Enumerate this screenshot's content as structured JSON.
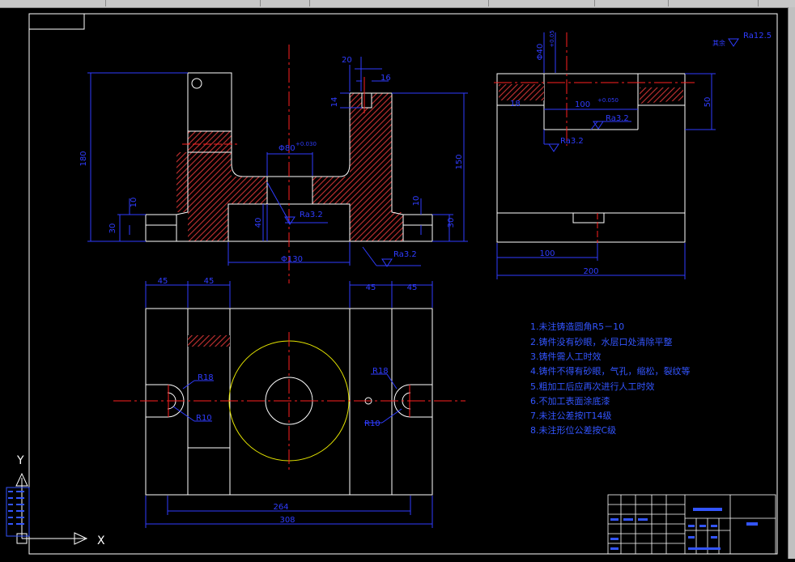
{
  "colors": {
    "background": "#000000",
    "outline": "#ffffff",
    "dimension": "#2f3cff",
    "centerline": "#ff2020",
    "hatch": "#c83232",
    "circle": "#e6e600",
    "notes": "#3355ff"
  },
  "ucs": {
    "x_label": "X",
    "y_label": "Y"
  },
  "front_view": {
    "dims": {
      "width_top": "20",
      "slot": "16",
      "slot_depth": "14",
      "height_left": "180",
      "height_right": "150",
      "base_left": "30",
      "base_right": "30",
      "step_left": "10",
      "step_right": "10",
      "bore_fit": "Φ80",
      "bore_tol": "+0.030",
      "bore_depth": "40",
      "bottom_width": "Φ130"
    },
    "roughness": [
      "Ra3.2",
      "Ra3.2"
    ]
  },
  "side_view": {
    "dims": {
      "keyway": "Φ40",
      "keyway_tol": "+0.05",
      "key_mark": "18",
      "key_width": "100",
      "key_tol": "+0.050",
      "height": "50",
      "half_width": "100",
      "total_width": "200"
    },
    "roughness": [
      "Ra3.2",
      "Ra3.2"
    ],
    "corner_note": "其余",
    "corner_roughness": "Ra12.5"
  },
  "top_view": {
    "dims": {
      "top_left_a": "45",
      "top_left_b": "45",
      "top_right_a": "45",
      "top_right_b": "45",
      "inner_width": "264",
      "total_width": "308"
    },
    "radii": {
      "left_outer": "R18",
      "left_inner": "R10",
      "right_outer": "R18",
      "right_inner": "R10"
    }
  },
  "notes": [
    "1.未注铸造圆角R5－10",
    "2.铸件没有砂眼，水层口处清除平整",
    "3.铸件需人工时效",
    "4.铸件不得有砂眼，气孔，缩松，裂纹等",
    "5.粗加工后应再次进行人工时效",
    "6.不加工表面涂底漆",
    "7.未注公差按IT14级",
    "8.未注形位公差按C级"
  ]
}
